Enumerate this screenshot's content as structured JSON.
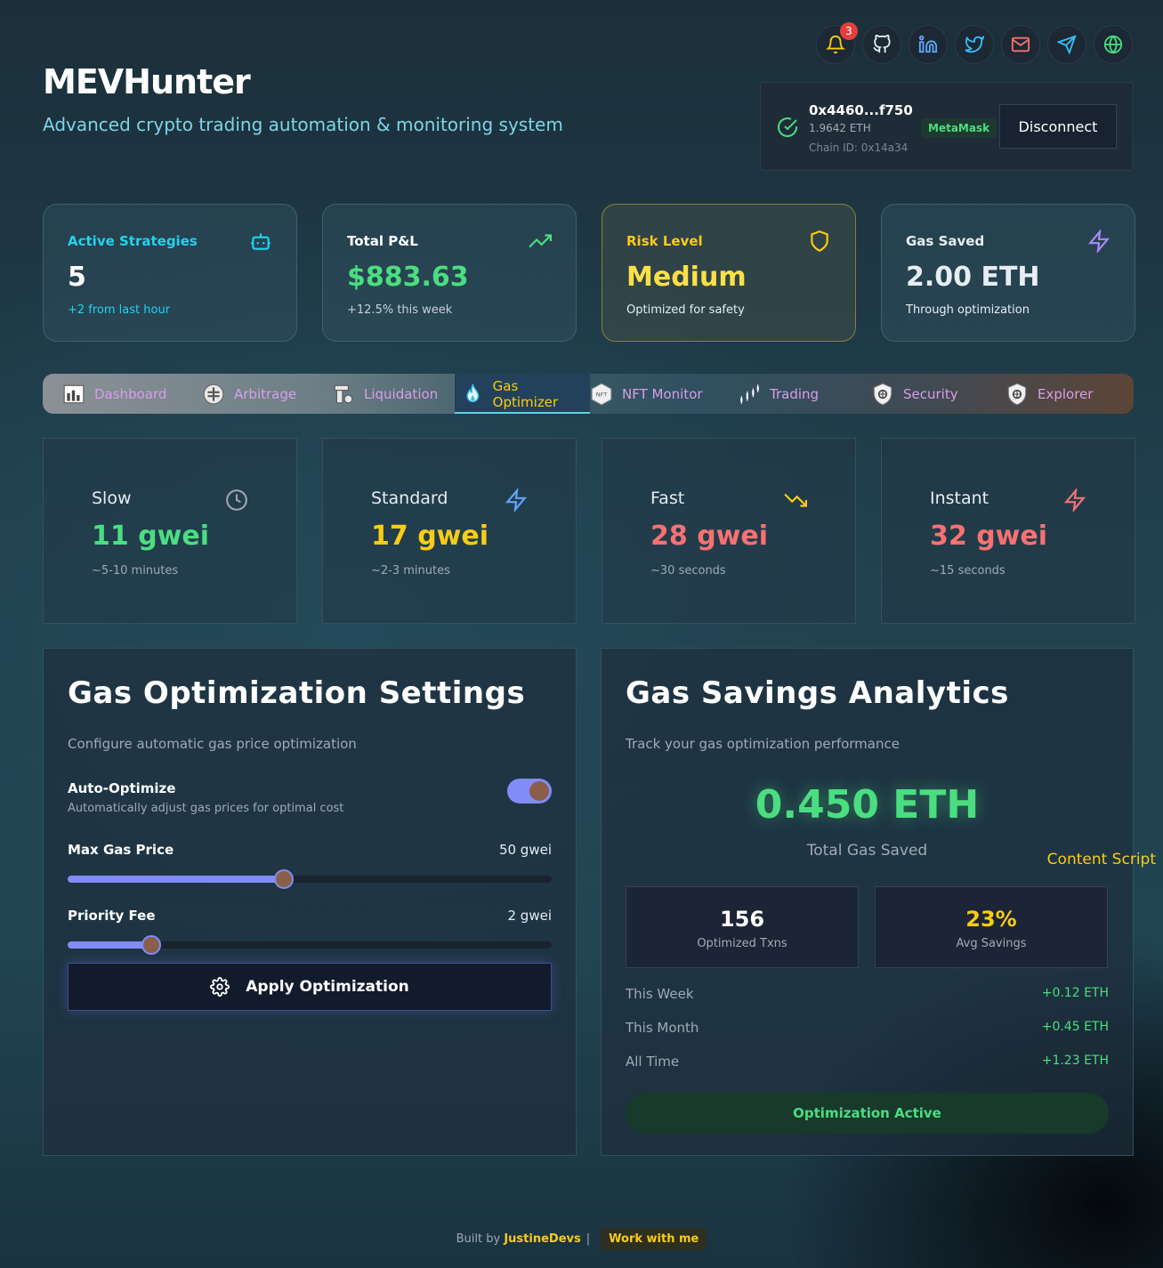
{
  "brand": {
    "title": "MEVHunter",
    "tagline": "Advanced crypto trading automation & monitoring system"
  },
  "notifications": {
    "count": "3"
  },
  "social": [
    "bell-icon",
    "github-icon",
    "linkedin-icon",
    "twitter-icon",
    "mail-icon",
    "telegram-icon",
    "globe-icon"
  ],
  "wallet": {
    "address": "0x4460...f750",
    "balance": "1.9642 ETH",
    "chain": "Chain ID: 0x14a34",
    "provider": "MetaMask",
    "disconnect_label": "Disconnect"
  },
  "stats": [
    {
      "label": "Active Strategies",
      "value": "5",
      "sub": "+2 from last hour",
      "icon": "robot-icon",
      "color": "#22d3ee"
    },
    {
      "label": "Total P&L",
      "value": "$883.63",
      "sub": "+12.5% this week",
      "icon": "trending-up-icon",
      "color": "#4ade80"
    },
    {
      "label": "Risk Level",
      "value": "Medium",
      "sub": "Optimized for safety",
      "icon": "shield-icon",
      "color": "#facc15"
    },
    {
      "label": "Gas Saved",
      "value": "2.00 ETH",
      "sub": "Through optimization",
      "icon": "zap-icon",
      "color": "#a78bfa"
    }
  ],
  "tabs": [
    {
      "label": "Dashboard",
      "icon": "dashboard-icon"
    },
    {
      "label": "Arbitrage",
      "icon": "arbitrage-icon"
    },
    {
      "label": "Liquidation",
      "icon": "liquidation-icon"
    },
    {
      "label": "Gas Optimizer",
      "icon": "flame-icon",
      "active": true
    },
    {
      "label": "NFT Monitor",
      "icon": "nft-icon"
    },
    {
      "label": "Trading",
      "icon": "candles-icon"
    },
    {
      "label": "Security",
      "icon": "security-shield-icon"
    },
    {
      "label": "Explorer",
      "icon": "explorer-shield-icon"
    }
  ],
  "gas_tiers": [
    {
      "name": "Slow",
      "price": "11 gwei",
      "time": "~5-10 minutes",
      "icon": "clock-icon",
      "color": "#4ade80"
    },
    {
      "name": "Standard",
      "price": "17 gwei",
      "time": "~2-3 minutes",
      "icon": "zap-icon",
      "color": "#facc15"
    },
    {
      "name": "Fast",
      "price": "28 gwei",
      "time": "~30 seconds",
      "icon": "trending-down-icon",
      "color": "#f87171"
    },
    {
      "name": "Instant",
      "price": "32 gwei",
      "time": "~15 seconds",
      "icon": "zap-icon",
      "color": "#f87171"
    }
  ],
  "settings": {
    "title": "Gas Optimization Settings",
    "description": "Configure automatic gas price optimization",
    "auto_optimize": {
      "label": "Auto-Optimize",
      "sub": "Automatically adjust gas prices for optimal cost",
      "enabled": true
    },
    "max_gas": {
      "label": "Max Gas Price",
      "value": "50 gwei",
      "fraction": 0.447
    },
    "priority_fee": {
      "label": "Priority Fee",
      "value": "2 gwei",
      "fraction": 0.172
    },
    "apply_label": "Apply Optimization"
  },
  "analytics": {
    "title": "Gas Savings Analytics",
    "description": "Track your gas optimization performance",
    "total": "0.450 ETH",
    "total_label": "Total Gas Saved",
    "optimized_txns": {
      "value": "156",
      "label": "Optimized Txns"
    },
    "avg_savings": {
      "value": "23%",
      "label": "Avg Savings"
    },
    "periods": [
      {
        "label": "This Week",
        "amount": "+0.12 ETH"
      },
      {
        "label": "This Month",
        "amount": "+0.45 ETH"
      },
      {
        "label": "All Time",
        "amount": "+1.23 ETH"
      }
    ],
    "status_label": "Optimization Active"
  },
  "overlay": {
    "content_script": "Content Script"
  },
  "footer": {
    "built_by": "Built by",
    "author": "JustineDevs",
    "separator": "|",
    "work_label": "Work with me"
  }
}
